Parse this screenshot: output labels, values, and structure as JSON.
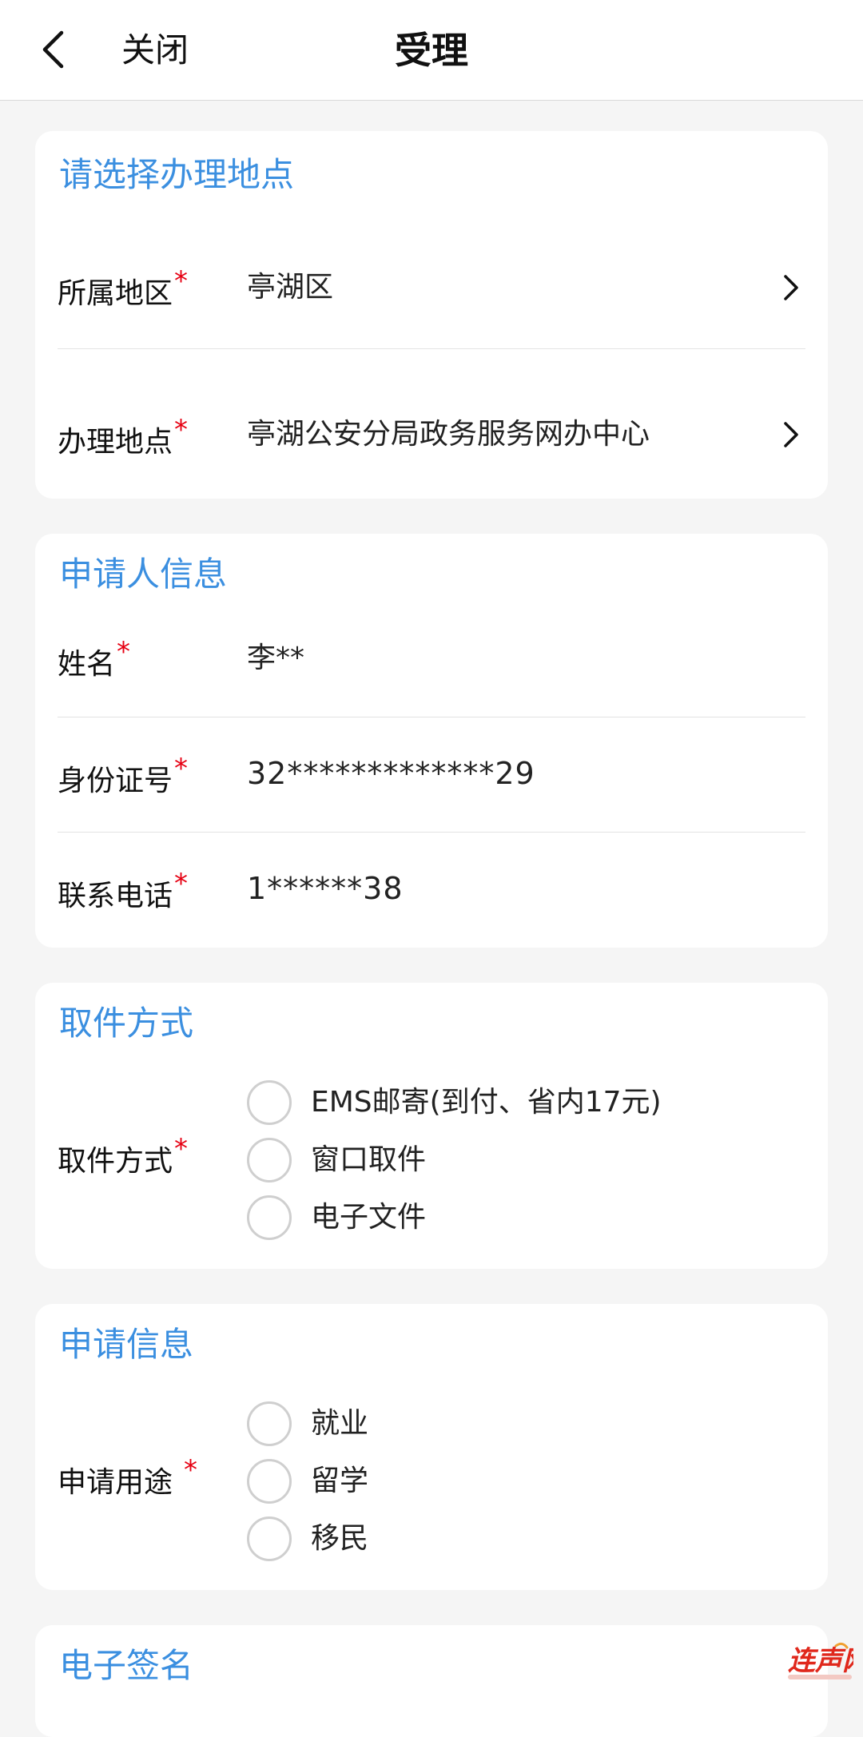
{
  "header": {
    "close_label": "关闭",
    "title": "受理"
  },
  "location": {
    "title": "请选择办理地点",
    "region_label": "所属地区",
    "region_value": "亭湖区",
    "place_label": "办理地点",
    "place_value": "亭湖公安分局政务服务网办中心"
  },
  "applicant": {
    "title": "申请人信息",
    "name_label": "姓名",
    "name_value": "李**",
    "id_label": "身份证号",
    "id_value": "32*************29",
    "phone_label": "联系电话",
    "phone_value": "1******38"
  },
  "pickup": {
    "title": "取件方式",
    "label": "取件方式",
    "options": [
      "EMS邮寄(到付、省内17元)",
      "窗口取件",
      "电子文件"
    ]
  },
  "apply_info": {
    "title": "申请信息",
    "purpose_label": "申请用途",
    "options": [
      "就业",
      "留学",
      "移民"
    ]
  },
  "signature": {
    "title": "电子签名"
  },
  "required_mark": "*",
  "colors": {
    "accent": "#3b8fe0",
    "required": "#e60012",
    "background": "#f5f5f5"
  }
}
